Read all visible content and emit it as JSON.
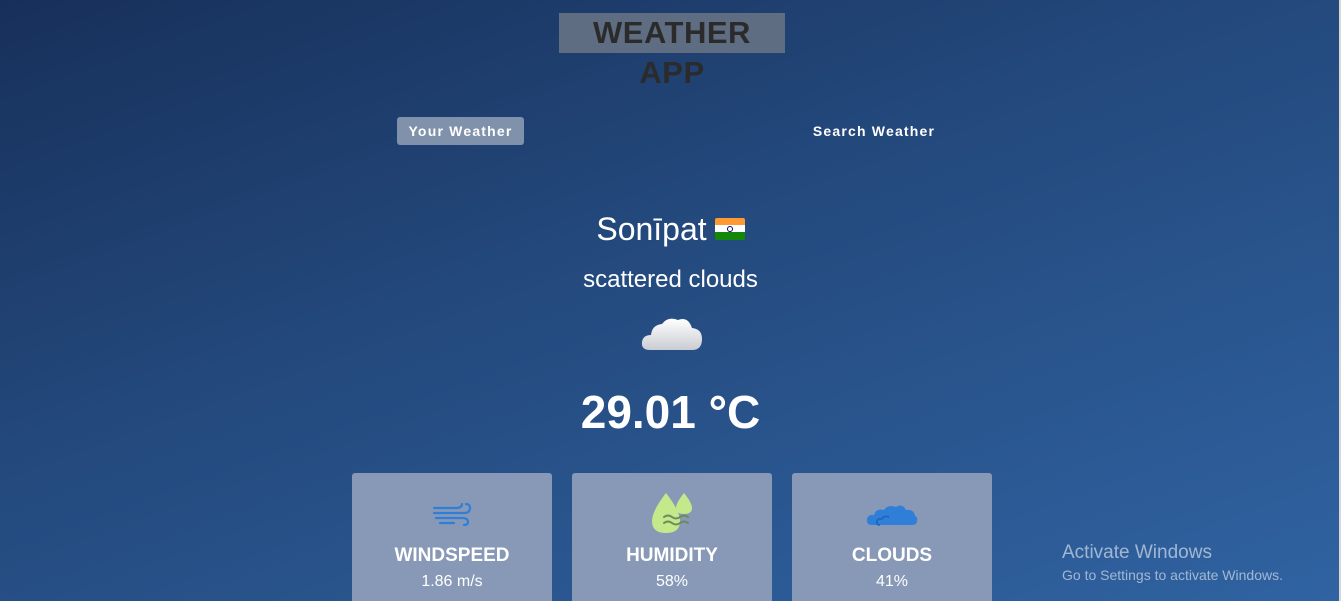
{
  "app": {
    "title": "WEATHER APP"
  },
  "tabs": [
    {
      "label": "Your Weather",
      "active": true
    },
    {
      "label": "Search Weather",
      "active": false
    }
  ],
  "weather": {
    "city": "Sonīpat",
    "country_flag": "india-flag-icon",
    "description": "scattered clouds",
    "icon": "cloud-icon",
    "temperature": "29.01 °C"
  },
  "cards": [
    {
      "label": "WINDSPEED",
      "value": "1.86 m/s",
      "icon": "wind-icon"
    },
    {
      "label": "HUMIDITY",
      "value": "58%",
      "icon": "humidity-icon"
    },
    {
      "label": "CLOUDS",
      "value": "41%",
      "icon": "cloud-icon"
    }
  ],
  "os_watermark": {
    "title": "Activate Windows",
    "subtitle": "Go to Settings to activate Windows."
  },
  "colors": {
    "background_top": "#17305a",
    "background_bottom": "#3063a2",
    "card_bg": "#8799b7",
    "active_tab_bg": "#7f91ab",
    "title_highlight": "#5f6d82",
    "icon_blue": "#2f7fd8",
    "icon_green": "#c3e98a"
  }
}
